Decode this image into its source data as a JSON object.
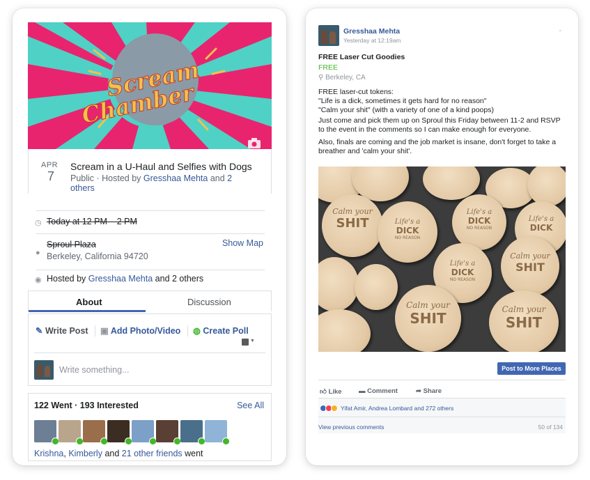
{
  "event": {
    "cover_text_line1": "Scream",
    "cover_text_line2": "Chamber",
    "camera_icon": "camera-icon",
    "month": "APR",
    "day": "7",
    "title": "Scream in a U-Haul and Selfies with Dogs",
    "privacy": "Public · Hosted by ",
    "host_name": "Gresshaa Mehta",
    "and": " and ",
    "others_link": "2 others",
    "time": "Today at 12 PM – 2 PM",
    "place_name": "Sproul Plaza",
    "address": "Berkeley, California 94720",
    "show_map": "Show Map",
    "hosted_prefix": "Hosted by ",
    "hosted_suffix": " and 2 others",
    "tabs": [
      {
        "label": "About",
        "active": true
      },
      {
        "label": "Discussion",
        "active": false
      }
    ],
    "composer": {
      "write_post": "Write Post",
      "add_photo": "Add Photo/Video",
      "create_poll": "Create Poll",
      "placeholder": "Write something..."
    },
    "stats": {
      "went": "122 Went · 193 Interested",
      "see_all": "See All",
      "friends_prefix_1": "Krishna",
      "friends_comma": ", ",
      "friends_prefix_2": "Kimberly",
      "friends_and": " and ",
      "friends_link": "21 other friends",
      "friends_suffix": " went"
    }
  },
  "post": {
    "author": "Gresshaa Mehta",
    "timestamp": "Yesterday at 12:19am",
    "item_title": "FREE Laser Cut Goodies",
    "price": "FREE",
    "location": "Berkeley, CA",
    "body_line1": "FREE laser-cut tokens:",
    "body_line2": "\"Life is a dick, sometimes it gets hard for no reason\"",
    "body_line3": "\"Calm your shit\" (with a variety of one of a kind poops)",
    "body_p2": "Just come and pick them up on Sproul this Friday between 11-2 and RSVP to the event in the comments so I can make enough for everyone.",
    "body_p3": "Also, finals are coming and the job market is insane, don't forget to take a breather and 'calm your shit'.",
    "post_button": "Post to More Places",
    "actions": {
      "like": "Like",
      "comment": "Comment",
      "share": "Share"
    },
    "reactions_text": "Yifat Amir, Andrea Lombard and 272 others",
    "view_comments": "View previous comments",
    "comment_count": "50 of 134",
    "token_calm": "Calm your",
    "token_shit": "SHIT",
    "token_life": "Life's a",
    "token_dick": "DICK",
    "token_no_reason": "NO REASON"
  },
  "colors": {
    "facebook_blue": "#4267b2",
    "link_blue": "#365899",
    "free_green": "#42b72a",
    "cover_pink": "#e8246e",
    "cover_teal": "#4fd1c5",
    "cover_yellow": "#f2c14e"
  }
}
